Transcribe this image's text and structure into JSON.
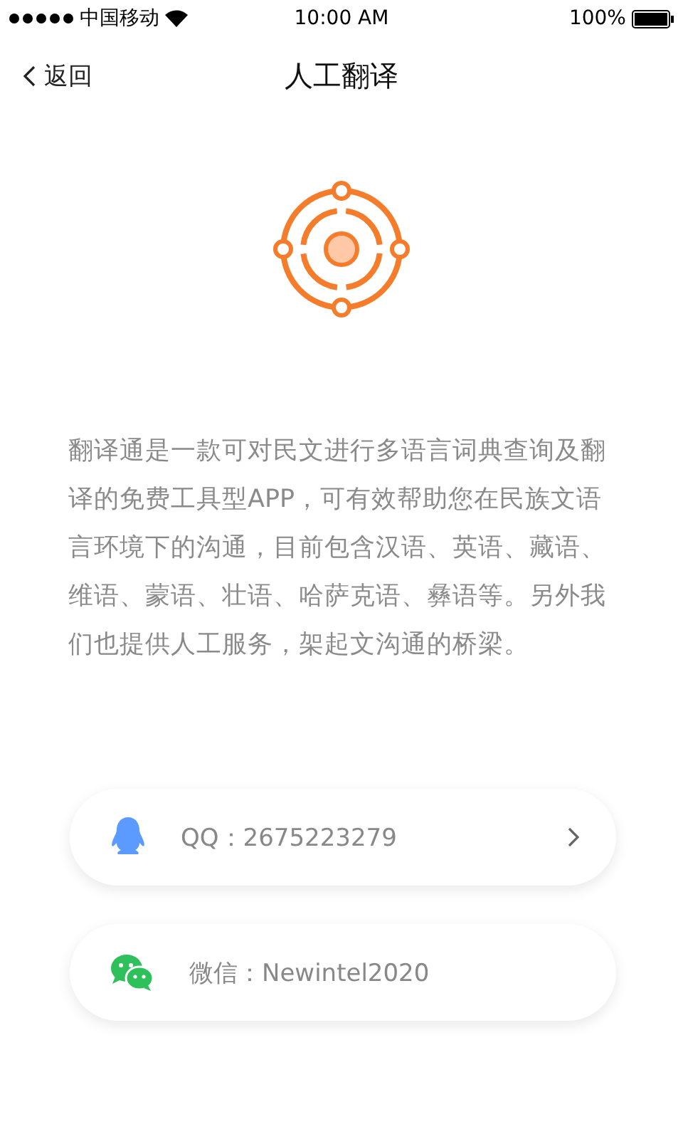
{
  "status_bar": {
    "carrier": "中国移动",
    "time": "10:00 AM",
    "battery": "100%"
  },
  "nav": {
    "back": "返回",
    "title": "人工翻译"
  },
  "description": "翻译通是一款可对民文进行多语言词典查询及翻译的免费工具型APP，可有效帮助您在民族文语言环境下的沟通，目前包含汉语、英语、藏语、维语、蒙语、壮语、哈萨克语、彝语等。另外我们也提供人工服务，架起文沟通的桥梁。",
  "contacts": [
    {
      "kind": "qq",
      "label": "QQ：2675223279",
      "arrow": true
    },
    {
      "kind": "wechat",
      "label": "微信：Newintel2020",
      "arrow": false
    }
  ]
}
